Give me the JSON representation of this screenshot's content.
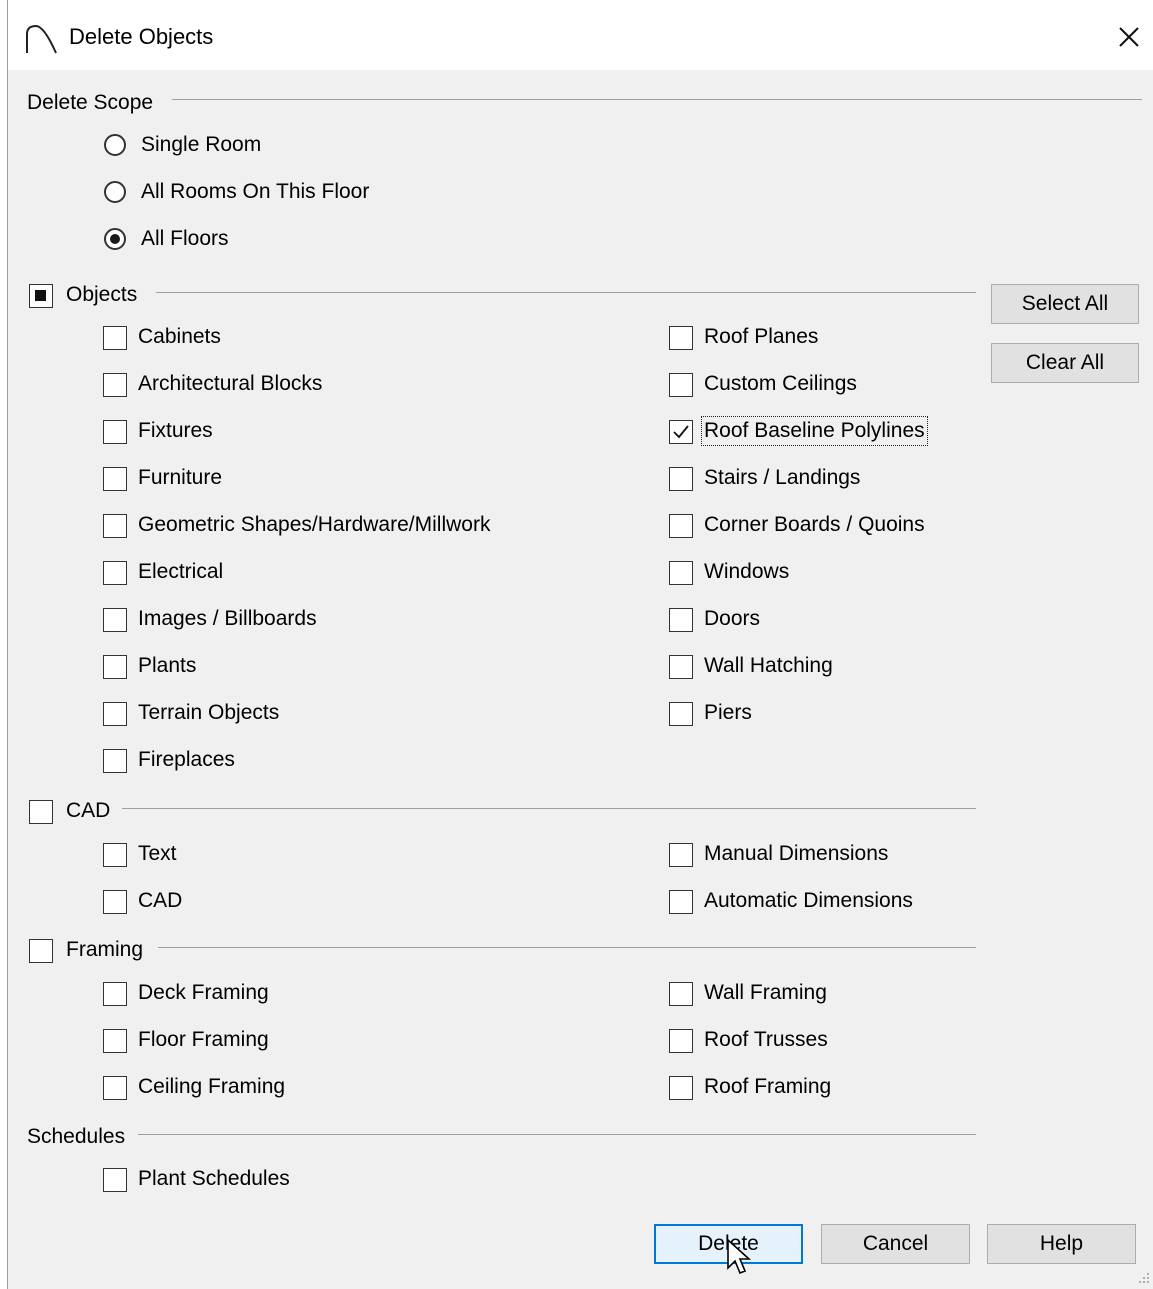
{
  "window": {
    "title": "Delete Objects"
  },
  "scope": {
    "label": "Delete Scope",
    "options": [
      {
        "label": "Single Room",
        "selected": false
      },
      {
        "label": "All Rooms On This Floor",
        "selected": false
      },
      {
        "label": "All Floors",
        "selected": true
      }
    ]
  },
  "objects": {
    "label": "Objects",
    "state": "indeterminate",
    "left": [
      {
        "label": "Cabinets",
        "checked": false
      },
      {
        "label": "Architectural Blocks",
        "checked": false
      },
      {
        "label": "Fixtures",
        "checked": false
      },
      {
        "label": "Furniture",
        "checked": false
      },
      {
        "label": "Geometric Shapes/Hardware/Millwork",
        "checked": false
      },
      {
        "label": "Electrical",
        "checked": false
      },
      {
        "label": "Images / Billboards",
        "checked": false
      },
      {
        "label": "Plants",
        "checked": false
      },
      {
        "label": "Terrain Objects",
        "checked": false
      },
      {
        "label": "Fireplaces",
        "checked": false
      }
    ],
    "right": [
      {
        "label": "Roof Planes",
        "checked": false
      },
      {
        "label": "Custom Ceilings",
        "checked": false
      },
      {
        "label": "Roof Baseline Polylines",
        "checked": true
      },
      {
        "label": "Stairs / Landings",
        "checked": false
      },
      {
        "label": "Corner Boards / Quoins",
        "checked": false
      },
      {
        "label": "Windows",
        "checked": false
      },
      {
        "label": "Doors",
        "checked": false
      },
      {
        "label": "Wall Hatching",
        "checked": false
      },
      {
        "label": "Piers",
        "checked": false
      }
    ]
  },
  "cad": {
    "label": "CAD",
    "checked": false,
    "left": [
      {
        "label": "Text",
        "checked": false
      },
      {
        "label": "CAD",
        "checked": false
      }
    ],
    "right": [
      {
        "label": "Manual Dimensions",
        "checked": false
      },
      {
        "label": "Automatic Dimensions",
        "checked": false
      }
    ]
  },
  "framing": {
    "label": "Framing",
    "checked": false,
    "left": [
      {
        "label": "Deck Framing",
        "checked": false
      },
      {
        "label": "Floor Framing",
        "checked": false
      },
      {
        "label": "Ceiling Framing",
        "checked": false
      }
    ],
    "right": [
      {
        "label": "Wall Framing",
        "checked": false
      },
      {
        "label": "Roof Trusses",
        "checked": false
      },
      {
        "label": "Roof Framing",
        "checked": false
      }
    ]
  },
  "schedules": {
    "label": "Schedules",
    "items": [
      {
        "label": "Plant Schedules",
        "checked": false
      }
    ]
  },
  "side_buttons": {
    "select_all": "Select All",
    "clear_all": "Clear All"
  },
  "footer": {
    "delete": "Delete",
    "cancel": "Cancel",
    "help": "Help"
  },
  "colors": {
    "accent": "#0078d7",
    "dialog_bg": "#f0f0f0",
    "button_bg": "#e1e1e1"
  }
}
